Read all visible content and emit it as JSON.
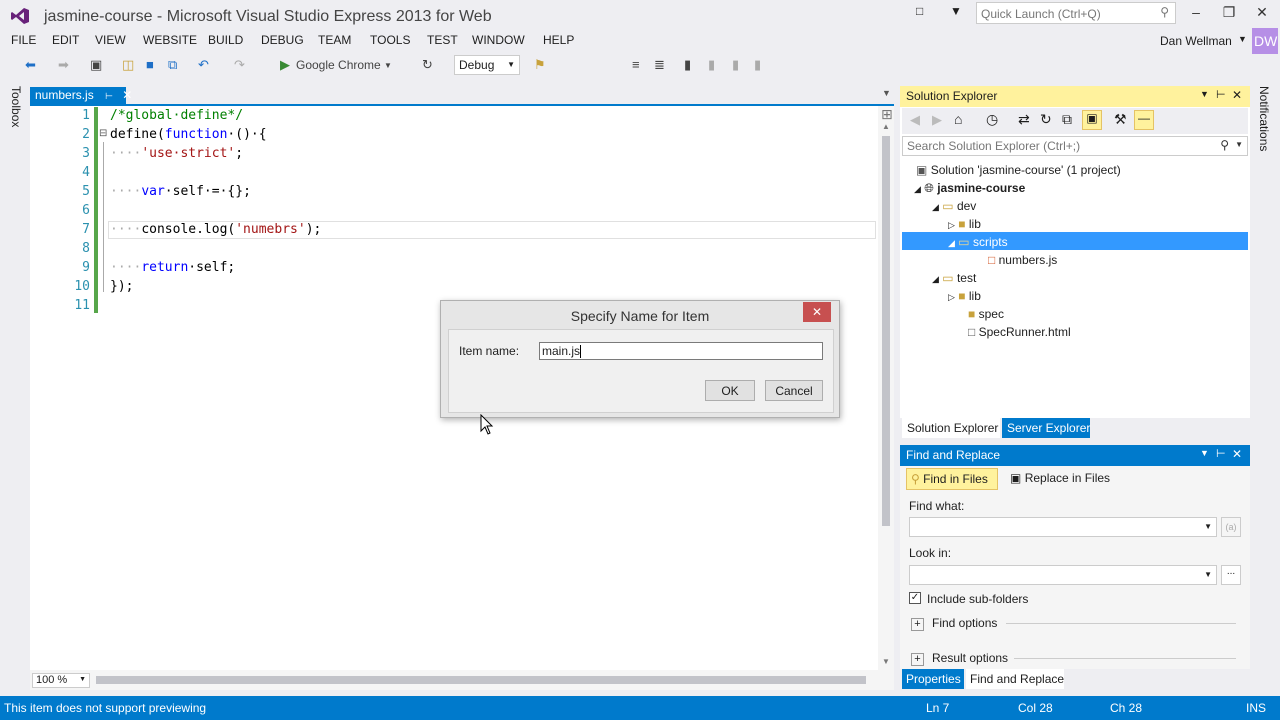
{
  "window": {
    "title": "jasmine-course - Microsoft Visual Studio Express 2013 for Web",
    "quick_launch_placeholder": "Quick Launch (Ctrl+Q)",
    "user": "Dan Wellman",
    "avatar_initials": "DW"
  },
  "menu": [
    "FILE",
    "EDIT",
    "VIEW",
    "WEBSITE",
    "BUILD",
    "DEBUG",
    "TEAM",
    "TOOLS",
    "TEST",
    "WINDOW",
    "HELP"
  ],
  "toolbar": {
    "run_target": "Google Chrome",
    "config": "Debug"
  },
  "side_labels": {
    "toolbox": "Toolbox",
    "notifications": "Notifications"
  },
  "editor": {
    "tab": "numbers.js",
    "zoom": "100 %",
    "line_numbers": [
      "1",
      "2",
      "3",
      "4",
      "5",
      "6",
      "7",
      "8",
      "9",
      "10",
      "11"
    ],
    "lines": {
      "l1": "/*global·define*/",
      "l2a": "define(",
      "l2b": "function",
      "l2c": "·()·{",
      "l3a": "····",
      "l3b": "'use·strict'",
      "l3c": ";",
      "l5a": "····",
      "l5b": "var",
      "l5c": "·self·=·{};",
      "l7a": "····",
      "l7b": "console.log(",
      "l7c": "'numebrs'",
      "l7d": ");",
      "l9a": "····",
      "l9b": "return",
      "l9c": "·self;",
      "l10": "});"
    }
  },
  "dialog": {
    "title": "Specify Name for Item",
    "label": "Item name:",
    "value": "main.js",
    "ok": "OK",
    "cancel": "Cancel"
  },
  "solution_explorer": {
    "title": "Solution Explorer",
    "search_placeholder": "Search Solution Explorer (Ctrl+;)",
    "tree": {
      "solution": "Solution 'jasmine-course' (1 project)",
      "project": "jasmine-course",
      "dev": "dev",
      "dev_lib": "lib",
      "scripts": "scripts",
      "numbers": "numbers.js",
      "test": "test",
      "test_lib": "lib",
      "spec": "spec",
      "specrunner": "SpecRunner.html"
    },
    "tabs": [
      "Solution Explorer",
      "Server Explorer"
    ]
  },
  "find_replace": {
    "title": "Find and Replace",
    "mode_find": "Find in Files",
    "mode_replace": "Replace in Files",
    "find_what": "Find what:",
    "look_in": "Look in:",
    "include_sub": "Include sub-folders",
    "find_options": "Find options",
    "result_options": "Result options",
    "tabs": [
      "Properties",
      "Find and Replace"
    ]
  },
  "status": {
    "message": "This item does not support previewing",
    "line": "Ln 7",
    "col": "Col 28",
    "ch": "Ch 28",
    "mode": "INS"
  },
  "colors": {
    "accent": "#007acc",
    "panel_active": "#fff29d",
    "selection": "#3399ff"
  }
}
